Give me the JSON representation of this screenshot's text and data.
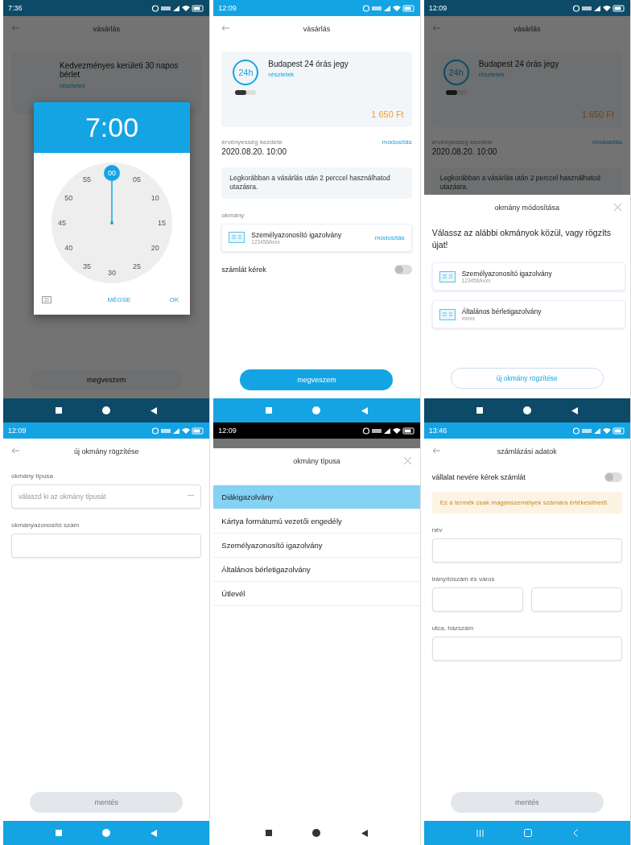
{
  "screens": [
    {
      "kind": "time_picker",
      "dimmed": true,
      "navigation_bar": {
        "kind": "classic"
      },
      "status_time": "7:36",
      "title": "vásárlás",
      "background": {
        "card_title": "Kedvezményes kerületi 30 napos bérlet",
        "card_link": "részletek",
        "button": {
          "label": "megveszem",
          "disabled": true
        }
      },
      "dialog": {
        "time": "7:00",
        "minutes": [
          {
            "label": "00",
            "selected": true
          },
          {
            "label": "05",
            "selected": false
          },
          {
            "label": "10",
            "selected": false
          },
          {
            "label": "15",
            "selected": false
          },
          {
            "label": "20",
            "selected": false
          },
          {
            "label": "25",
            "selected": false
          },
          {
            "label": "30",
            "selected": false
          },
          {
            "label": "35",
            "selected": false
          },
          {
            "label": "40",
            "selected": false
          },
          {
            "label": "45",
            "selected": false
          },
          {
            "label": "50",
            "selected": false
          },
          {
            "label": "55",
            "selected": false
          }
        ],
        "cancel": "MÉGSE",
        "ok": "OK"
      }
    },
    {
      "kind": "purchase",
      "dimmed": false,
      "navigation_bar": {
        "kind": "classic"
      },
      "status_time": "12:09",
      "title": "vásárlás",
      "ticket": {
        "badge": "24h",
        "name": "Budapest 24 órás jegy",
        "link": "részletek",
        "price": "1 650 Ft"
      },
      "validity": {
        "label": "érvényesség kezdete",
        "value": "2020.08.20. 10:00",
        "link": "módosítás"
      },
      "notice": "Legkorábban a vásárlás után 2 perccel használhatod utazásra.",
      "document": {
        "label": "okmány",
        "name": "Személyazonosító igazolvány",
        "number": "123456Axxx",
        "link": "módosítás"
      },
      "invoice": {
        "label": "számlát kérek",
        "on": false
      },
      "button": {
        "label": "megveszem",
        "disabled": false
      }
    },
    {
      "kind": "document_sheet",
      "dimmed": true,
      "navigation_bar": {
        "kind": "classic"
      },
      "status_time": "12:09",
      "title": "vásárlás",
      "ticket": {
        "badge": "24h",
        "name": "Budapest 24 órás jegy",
        "link": "részletek",
        "price": "1 650 Ft"
      },
      "validity": {
        "label": "érvényesség kezdete",
        "value": "2020.08.20. 10:00",
        "link": "módosítás"
      },
      "notice": "Legkorábban a vásárlás után 2 perccel használhatod utazásra.",
      "sheet": {
        "title": "okmány módosítása",
        "prompt": "Válassz az alábbi okmányok közül, vagy rögzíts újat!",
        "documents": [
          {
            "name": "Személyazonosító igazolvány",
            "number": "123456Axxx"
          },
          {
            "name": "Általános bérletigazolvány",
            "number": "xxxxx"
          }
        ],
        "button": "új okmány rögzítése"
      }
    },
    {
      "kind": "new_document",
      "dimmed": false,
      "navigation_bar": {
        "kind": "classic"
      },
      "status_time": "12:09",
      "title": "új okmány rögzítése",
      "fields": [
        {
          "kind": "select",
          "label": "okmány típusa",
          "placeholder": "válaszd ki az okmány típusát"
        },
        {
          "kind": "text",
          "label": "okmányazonosító szám"
        }
      ],
      "button": {
        "label": "mentés",
        "disabled": true
      }
    },
    {
      "kind": "type_picker",
      "dimmed": true,
      "navigation_bar": {
        "kind": "classic"
      },
      "status_time": "12:09",
      "title": "okmány típusa",
      "options": [
        {
          "label": "Diákigazolvány",
          "selected": true
        },
        {
          "label": "Kártya formátumú vezetői engedély",
          "selected": false
        },
        {
          "label": "Személyazonosító igazolvány",
          "selected": false
        },
        {
          "label": "Általános bérletigazolvány",
          "selected": false
        },
        {
          "label": "Útlevél",
          "selected": false
        }
      ]
    },
    {
      "kind": "billing",
      "dimmed": false,
      "navigation_bar": {
        "kind": "samsung"
      },
      "status_time": "13:46",
      "title": "számlázási adatok",
      "company": {
        "label": "vállalat nevére kérek számlát",
        "on": false
      },
      "warning": "Ez a termék csak magánszemélyek számára értékesíthető.",
      "fields": [
        {
          "kind": "single",
          "label": "név"
        },
        {
          "kind": "split",
          "label": "irányítószám és város"
        },
        {
          "kind": "single",
          "label": "utca, házszám"
        }
      ],
      "button": {
        "label": "mentés",
        "disabled": true
      }
    }
  ]
}
